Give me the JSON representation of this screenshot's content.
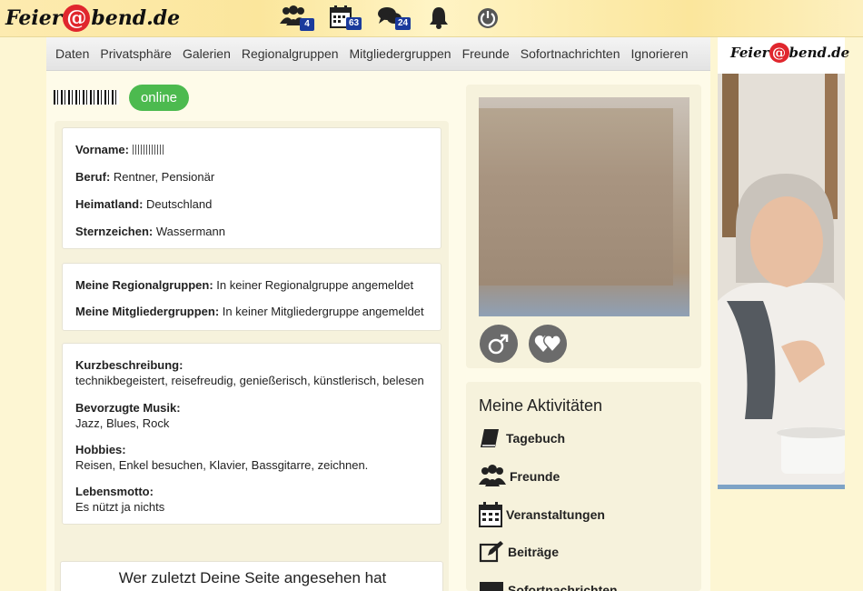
{
  "header": {
    "logo": {
      "before": "Feier",
      "at": "@",
      "after": "bend.de"
    },
    "icons": [
      {
        "name": "members-icon",
        "badge": "4"
      },
      {
        "name": "calendar-icon",
        "badge": "63"
      },
      {
        "name": "chat-icon",
        "badge": "24"
      },
      {
        "name": "bell-icon",
        "badge": ""
      },
      {
        "name": "power-icon",
        "badge": ""
      }
    ]
  },
  "tabs": [
    "Daten",
    "Privatsphäre",
    "Galerien",
    "Regionalgruppen",
    "Mitgliedergruppen",
    "Freunde",
    "Sofortnachrichten",
    "Ignorieren"
  ],
  "profile": {
    "status": "online",
    "basic": {
      "vorname_label": "Vorname:",
      "beruf_label": "Beruf:",
      "beruf": "Rentner, Pensionär",
      "heimatland_label": "Heimatland:",
      "heimatland": "Deutschland",
      "sternzeichen_label": "Sternzeichen:",
      "sternzeichen": "Wassermann"
    },
    "groups": {
      "regional_label": "Meine Regionalgruppen:",
      "regional": "In keiner Regionalgruppe angemeldet",
      "mitglieder_label": "Meine Mitgliedergruppen:",
      "mitglieder": "In keiner Mitgliedergruppe angemeldet"
    },
    "about": {
      "kurz_label": "Kurzbeschreibung:",
      "kurz": "technikbegeistert, reisefreudig, genießerisch, künstlerisch, belesen",
      "musik_label": "Bevorzugte Musik:",
      "musik": "Jazz, Blues, Rock",
      "hobbies_label": "Hobbies:",
      "hobbies": "Reisen, Enkel besuchen, Klavier, Bassgitarre, zeichnen.",
      "motto_label": "Lebensmotto:",
      "motto": "Es nützt ja nichts"
    },
    "visitors_title": "Wer zuletzt Deine Seite angesehen hat"
  },
  "sidebar": {
    "gender_icon": "male-icon",
    "relationship_icon": "hearts-icon",
    "activities_title": "Meine Aktivitäten",
    "activities": [
      {
        "label": "Tagebuch",
        "icon": "book-icon"
      },
      {
        "label": "Freunde",
        "icon": "friends-icon"
      },
      {
        "label": "Veranstaltungen",
        "icon": "calendar-icon"
      },
      {
        "label": "Beiträge",
        "icon": "edit-icon"
      },
      {
        "label": "Sofortnachrichten",
        "icon": "message-icon"
      }
    ]
  },
  "ad": {
    "logo_before": "Feier",
    "logo_at": "@",
    "logo_after": "bend.de"
  }
}
